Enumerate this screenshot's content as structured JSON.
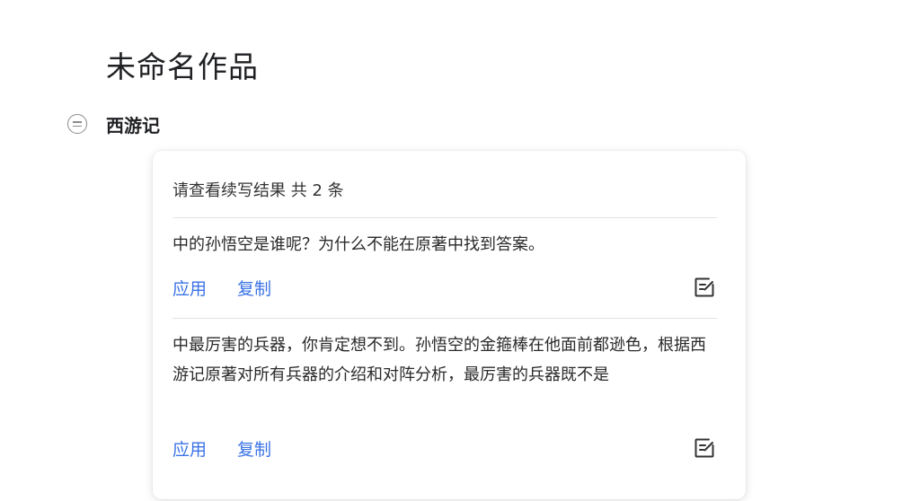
{
  "document": {
    "title": "未命名作品"
  },
  "section": {
    "title": "西游记",
    "collapse_icon": "collapse-circle-icon"
  },
  "results_panel": {
    "header": "请查看续写结果 共 2 条",
    "results": [
      {
        "text": "中的孙悟空是谁呢？为什么不能在原著中找到答案。",
        "apply_label": "应用",
        "copy_label": "复制",
        "edit_icon": "edit-note-icon"
      },
      {
        "text": "中最厉害的兵器，你肯定想不到。孙悟空的金箍棒在他面前都逊色，根据西游记原著对所有兵器的介绍和对阵分析，最厉害的兵器既不是",
        "apply_label": "应用",
        "copy_label": "复制",
        "edit_icon": "edit-note-icon"
      }
    ]
  },
  "colors": {
    "link": "#3b73e6",
    "text": "#2a2a2a",
    "divider": "#e2e2e2"
  }
}
